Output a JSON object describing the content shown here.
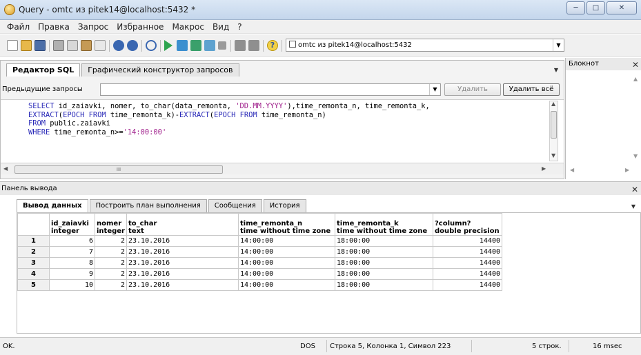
{
  "window": {
    "title": "Query - omtc из pitek14@localhost:5432 *"
  },
  "menu": [
    "Файл",
    "Правка",
    "Запрос",
    "Избранное",
    "Макрос",
    "Вид",
    "?"
  ],
  "toolbar": {
    "connection": "omtc из pitek14@localhost:5432"
  },
  "editor": {
    "tabs": [
      "Редактор SQL",
      "Графический конструктор запросов"
    ],
    "previous_label": "Предыдущие запросы",
    "previous_value": "",
    "delete_label": "Удалить",
    "delete_all_label": "Удалить всё",
    "sql_lines": [
      "SELECT id_zaiavki, nomer, to_char(data_remonta, 'DD.MM.YYYY'),time_remonta_n, time_remonta_k,",
      "EXTRACT(EPOCH FROM time_remonta_k)-EXTRACT(EPOCH FROM time_remonta_n)",
      "FROM public.zaiavki",
      "WHERE time_remonta_n>='14:00:00'"
    ],
    "hscroll_grip": "III"
  },
  "notepad": {
    "title": "Блокнот"
  },
  "output": {
    "title": "Панель вывода",
    "tabs": [
      "Вывод данных",
      "Построить план выполнения",
      "Сообщения",
      "История"
    ],
    "columns": [
      {
        "name": "id_zaiavki",
        "type": "integer"
      },
      {
        "name": "nomer",
        "type": "integer"
      },
      {
        "name": "to_char",
        "type": "text"
      },
      {
        "name": "time_remonta_n",
        "type": "time without time zone"
      },
      {
        "name": "time_remonta_k",
        "type": "time without time zone"
      },
      {
        "name": "?column?",
        "type": "double precision"
      }
    ],
    "rows": [
      {
        "n": "1",
        "cells": [
          "6",
          "2",
          "23.10.2016",
          "14:00:00",
          "18:00:00",
          "14400"
        ]
      },
      {
        "n": "2",
        "cells": [
          "7",
          "2",
          "23.10.2016",
          "14:00:00",
          "18:00:00",
          "14400"
        ]
      },
      {
        "n": "3",
        "cells": [
          "8",
          "2",
          "23.10.2016",
          "14:00:00",
          "18:00:00",
          "14400"
        ]
      },
      {
        "n": "4",
        "cells": [
          "9",
          "2",
          "23.10.2016",
          "14:00:00",
          "18:00:00",
          "14400"
        ]
      },
      {
        "n": "5",
        "cells": [
          "10",
          "2",
          "23.10.2016",
          "14:00:00",
          "18:00:00",
          "14400"
        ]
      }
    ]
  },
  "status": {
    "state": "OK.",
    "encoding": "DOS",
    "position": "Строка 5, Колонка 1, Символ 223",
    "rows": "5 строк.",
    "time": "16 msec"
  }
}
